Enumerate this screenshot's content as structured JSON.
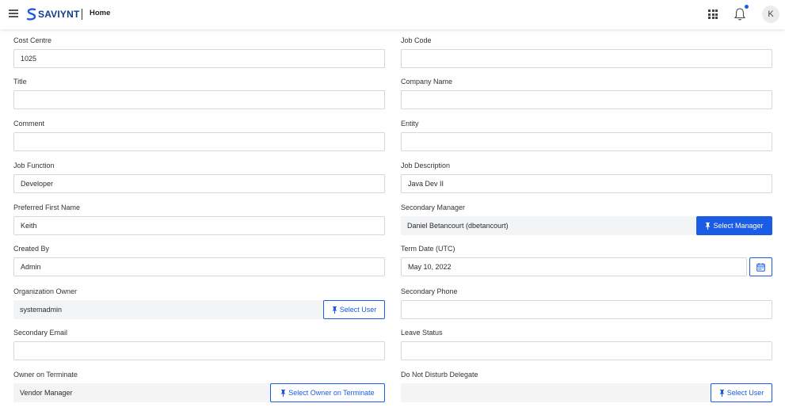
{
  "header": {
    "logo_text": "SAVIYNT",
    "title": "Home",
    "avatar_initial": "K",
    "accent_color": "#1a5ce6"
  },
  "form": {
    "left": [
      {
        "label": "Cost Centre",
        "value": "1025",
        "placeholder": ""
      },
      {
        "label": "Title",
        "value": "",
        "placeholder": ""
      },
      {
        "label": "Comment",
        "value": "",
        "placeholder": ""
      },
      {
        "label": "Job Function",
        "value": "Developer",
        "placeholder": ""
      },
      {
        "label": "Preferred First Name",
        "value": "Keith",
        "placeholder": ""
      },
      {
        "label": "Created By",
        "value": "Admin",
        "placeholder": ""
      },
      {
        "label": "Organization Owner",
        "value": "systemadmin",
        "button": "Select User"
      },
      {
        "label": "Secondary Email",
        "value": "",
        "placeholder": ""
      },
      {
        "label": "Owner on Terminate",
        "value": "Vendor Manager",
        "button": "Select Owner on Terminate"
      }
    ],
    "right": [
      {
        "label": "Job Code",
        "value": "",
        "placeholder": ""
      },
      {
        "label": "Company Name",
        "value": "",
        "placeholder": ""
      },
      {
        "label": "Entity",
        "value": "",
        "placeholder": ""
      },
      {
        "label": "Job Description",
        "value": "Java Dev II",
        "placeholder": ""
      },
      {
        "label": "Secondary Manager",
        "value": "Daniel Betancourt (dbetancourt)",
        "button": "Select Manager"
      },
      {
        "label": "Term Date (UTC)",
        "value": "May 10, 2022"
      },
      {
        "label": "Secondary Phone",
        "value": "",
        "placeholder": ""
      },
      {
        "label": "Leave Status",
        "value": "",
        "placeholder": ""
      },
      {
        "label": "Do Not Disturb Delegate",
        "value": "",
        "button": "Select User"
      }
    ]
  }
}
